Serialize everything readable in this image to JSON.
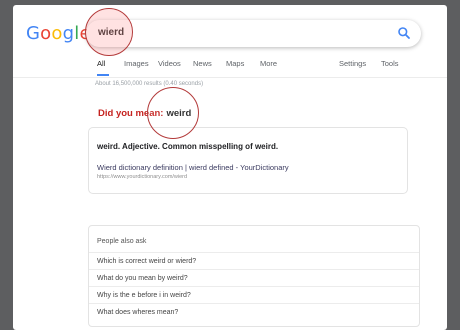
{
  "logo": {
    "letters": [
      {
        "ch": "G",
        "color": "#4285f4"
      },
      {
        "ch": "o",
        "color": "#ea4335"
      },
      {
        "ch": "o",
        "color": "#fbbc05"
      },
      {
        "ch": "g",
        "color": "#4285f4"
      },
      {
        "ch": "l",
        "color": "#34a853"
      },
      {
        "ch": "e",
        "color": "#ea4335"
      }
    ]
  },
  "search": {
    "query": "wierd",
    "icon": "search-icon"
  },
  "tabs": [
    {
      "label": "All",
      "active": true
    },
    {
      "label": "Images"
    },
    {
      "label": "Videos"
    },
    {
      "label": "News"
    },
    {
      "label": "Maps"
    },
    {
      "label": "More"
    },
    {
      "label": "Settings"
    },
    {
      "label": "Tools"
    }
  ],
  "stats": "About 16,500,000 results (0.40 seconds)",
  "did_you_mean": {
    "prefix": "Did you mean:",
    "suggestion": "weird"
  },
  "result": {
    "title": "weird. Adjective. Common misspelling of weird.",
    "link": "Wierd dictionary definition | wierd defined - YourDictionary",
    "url": "https://www.yourdictionary.com/wierd"
  },
  "people_also_ask": {
    "heading": "People also ask",
    "questions": [
      "Which is correct weird or wierd?",
      "What do you mean by weird?",
      "Why is the e before i in weird?",
      "What does wheres mean?"
    ]
  },
  "colors": {
    "highlight_ring": "#b33a3a",
    "did_you_mean": "#c5221f",
    "active_tab": "#4285f4"
  }
}
